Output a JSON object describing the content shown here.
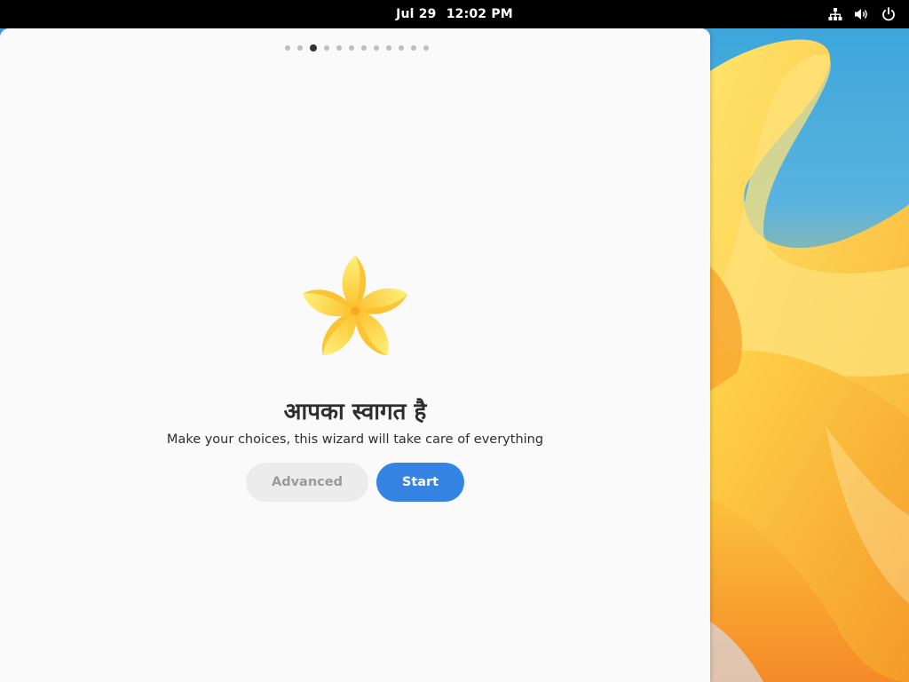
{
  "topbar": {
    "date": "Jul 29",
    "time": "12:02 PM",
    "tray_icons": [
      "network-icon",
      "volume-icon",
      "power-icon"
    ]
  },
  "pager": {
    "total_pages": 12,
    "current_page": 3
  },
  "welcome": {
    "logo": "flower-logo",
    "title": "आपका स्वागत है",
    "subtitle": "Make your choices, this wizard will take care of everything"
  },
  "buttons": {
    "advanced": "Advanced",
    "start": "Start"
  },
  "colors": {
    "accent": "#3584e4",
    "window_bg": "#fafafa",
    "topbar_bg": "#000000",
    "advanced_bg": "#ececec",
    "advanced_text": "#9a9a9a"
  }
}
